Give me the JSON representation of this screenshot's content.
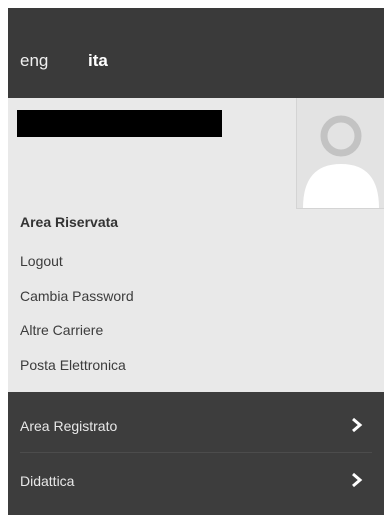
{
  "language": {
    "options": [
      "eng",
      "ita"
    ],
    "active": "ita"
  },
  "user": {
    "name": "",
    "avatar_icon": "user-avatar-placeholder-icon"
  },
  "reserved_area": {
    "title": "Area Riservata",
    "links": [
      "Logout",
      "Cambia Password",
      "Altre Carriere",
      "Posta Elettronica"
    ]
  },
  "menu": {
    "items": [
      {
        "label": "Area Registrato",
        "icon": "chevron-right-icon"
      },
      {
        "label": "Didattica",
        "icon": "chevron-right-icon"
      }
    ]
  },
  "colors": {
    "header_bg": "#3a3a3a",
    "panel_bg": "#e9e9e9",
    "menu_bg": "#3d3d3d",
    "text": "#333333"
  }
}
